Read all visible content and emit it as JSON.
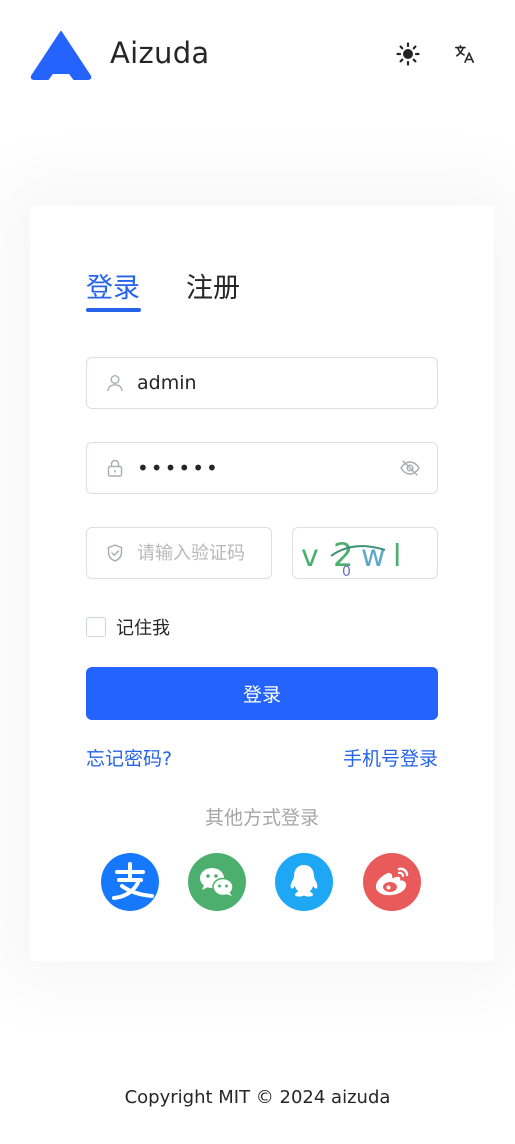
{
  "header": {
    "app_name": "Aizuda",
    "brand_color": "#2563ff",
    "theme_icon": "sun-icon",
    "language_icon": "translate-icon"
  },
  "login_card": {
    "tabs": [
      {
        "label": "登录",
        "active": true
      },
      {
        "label": "注册",
        "active": false
      }
    ],
    "username": {
      "value": "admin",
      "icon": "user-icon"
    },
    "password": {
      "value": "••••••",
      "icon": "lock-icon",
      "toggle_icon": "eye-off-icon"
    },
    "captcha": {
      "placeholder": "请输入验证码",
      "icon": "shield-icon",
      "image_text": "v2wl"
    },
    "remember_label": "记住我",
    "remember_checked": false,
    "login_button": "登录",
    "forgot_password": "忘记密码?",
    "phone_login": "手机号登录",
    "other_login_title": "其他方式登录",
    "social_logins": [
      {
        "name": "alipay",
        "color": "#1677ff"
      },
      {
        "name": "wechat",
        "color": "#4caf6e"
      },
      {
        "name": "qq",
        "color": "#1ea7f5"
      },
      {
        "name": "weibo",
        "color": "#e95a5a"
      }
    ]
  },
  "footer": {
    "copyright": "Copyright MIT © 2024 aizuda"
  }
}
